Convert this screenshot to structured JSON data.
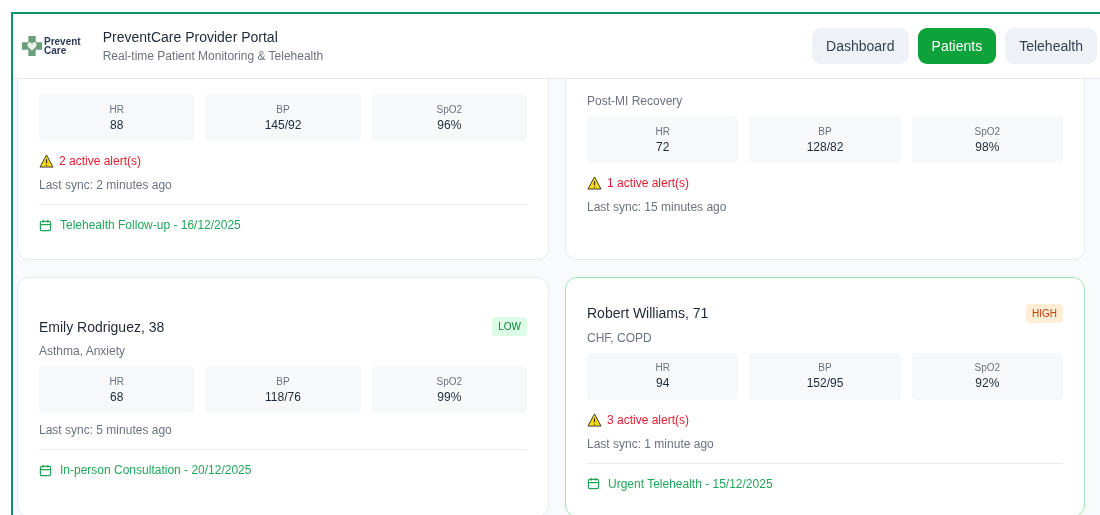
{
  "header": {
    "logo": {
      "line_1": "Prevent",
      "line_2": "Care"
    },
    "title": "PreventCare Provider Portal",
    "subtitle": "Real-time Patient Monitoring & Telehealth"
  },
  "nav": [
    {
      "label": "Dashboard",
      "selected": false
    },
    {
      "label": "Patients",
      "selected": true
    },
    {
      "label": "Telehealth",
      "selected": false
    }
  ],
  "patients": [
    {
      "highlighted": false,
      "vitals": [
        {
          "label": "HR",
          "value": "88"
        },
        {
          "label": "BP",
          "value": "145/92"
        },
        {
          "label": "SpO2",
          "value": "96%"
        }
      ],
      "alerts": "2 active alert(s)",
      "last_sync": "Last sync: 2 minutes ago",
      "appointment": "Telehealth Follow-up - 16/12/2025"
    },
    {
      "highlighted": false,
      "conditions": "Post-MI Recovery",
      "vitals": [
        {
          "label": "HR",
          "value": "72"
        },
        {
          "label": "BP",
          "value": "128/82"
        },
        {
          "label": "SpO2",
          "value": "98%"
        }
      ],
      "alerts": "1 active alert(s)",
      "last_sync": "Last sync: 15 minutes ago"
    },
    {
      "highlighted": false,
      "name": "Emily Rodriguez, 38",
      "risk": {
        "label": "LOW",
        "kind": "low"
      },
      "conditions": "Asthma, Anxiety",
      "vitals": [
        {
          "label": "HR",
          "value": "68"
        },
        {
          "label": "BP",
          "value": "118/76"
        },
        {
          "label": "SpO2",
          "value": "99%"
        }
      ],
      "last_sync": "Last sync: 5 minutes ago",
      "appointment": "In-person Consultation - 20/12/2025"
    },
    {
      "highlighted": true,
      "name": "Robert Williams, 71",
      "risk": {
        "label": "HIGH",
        "kind": "high"
      },
      "conditions": "CHF, COPD",
      "vitals": [
        {
          "label": "HR",
          "value": "94"
        },
        {
          "label": "BP",
          "value": "152/95"
        },
        {
          "label": "SpO2",
          "value": "92%"
        }
      ],
      "alerts": "3 active alert(s)",
      "last_sync": "Last sync: 1 minute ago",
      "appointment": "Urgent Telehealth - 15/12/2025"
    }
  ]
}
